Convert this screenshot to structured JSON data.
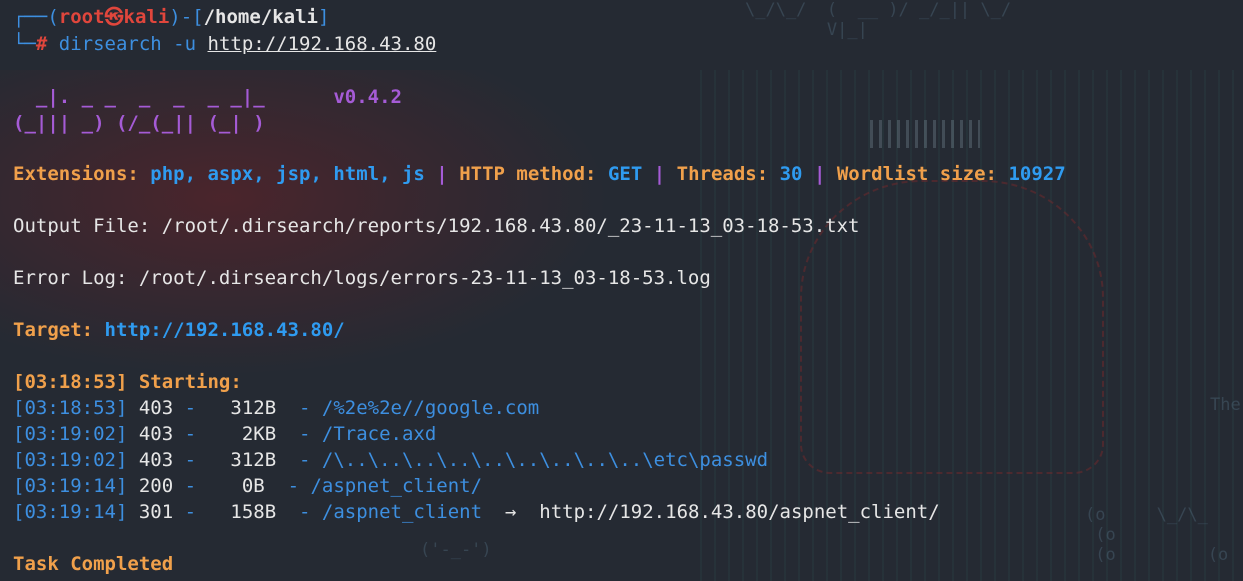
{
  "prompt": {
    "frame_top": "┌──(",
    "user": "root㉿kali",
    "sep": ")-[",
    "path": "/home/kali",
    "close": "]",
    "frame_bottom": "└─",
    "hash": "#",
    "command": "dirsearch -u",
    "url": "http://192.168.43.80"
  },
  "banner": {
    "line1": "  _|. _ _  _  _  _ _|_    ",
    "version": "v0.4.2",
    "line2": "(_||| _) (/_(_|| (_| )"
  },
  "config": {
    "extensions_label": "Extensions:",
    "extensions_value": "php, aspx, jsp, html, js",
    "pipe": "|",
    "method_label": "HTTP method:",
    "method_value": "GET",
    "threads_label": "Threads:",
    "threads_value": "30",
    "wordlist_label": "Wordlist size:",
    "wordlist_value": "10927"
  },
  "output_file": "Output File: /root/.dirsearch/reports/192.168.43.80/_23-11-13_03-18-53.txt",
  "error_log": "Error Log: /root/.dirsearch/logs/errors-23-11-13_03-18-53.log",
  "target": {
    "label": "Target:",
    "value": "http://192.168.43.80/"
  },
  "starting": "[03:18:53] Starting:",
  "results": [
    {
      "time": "[03:18:53]",
      "code": "403",
      "size": " 312B",
      "path": "/%2e%2e//google.com",
      "redirect": ""
    },
    {
      "time": "[03:19:02]",
      "code": "403",
      "size": "   2KB",
      "path": "/Trace.axd",
      "redirect": ""
    },
    {
      "time": "[03:19:02]",
      "code": "403",
      "size": " 312B",
      "path": "/\\..\\..\\..\\..\\..\\..\\..\\..\\..\\etc\\passwd",
      "redirect": ""
    },
    {
      "time": "[03:19:14]",
      "code": "200",
      "size": "   0B",
      "path": "/aspnet_client/",
      "redirect": ""
    },
    {
      "time": "[03:19:14]",
      "code": "301",
      "size": " 158B",
      "path": "/aspnet_client",
      "arrow": "→",
      "redirect": "http://192.168.43.80/aspnet_client/"
    }
  ],
  "task_completed": "Task Completed",
  "colors": {
    "background": "#252a33",
    "orange": "#f0a04b",
    "blue": "#2f9bf0",
    "purple": "#a55bd6",
    "red": "#e0463c"
  }
}
